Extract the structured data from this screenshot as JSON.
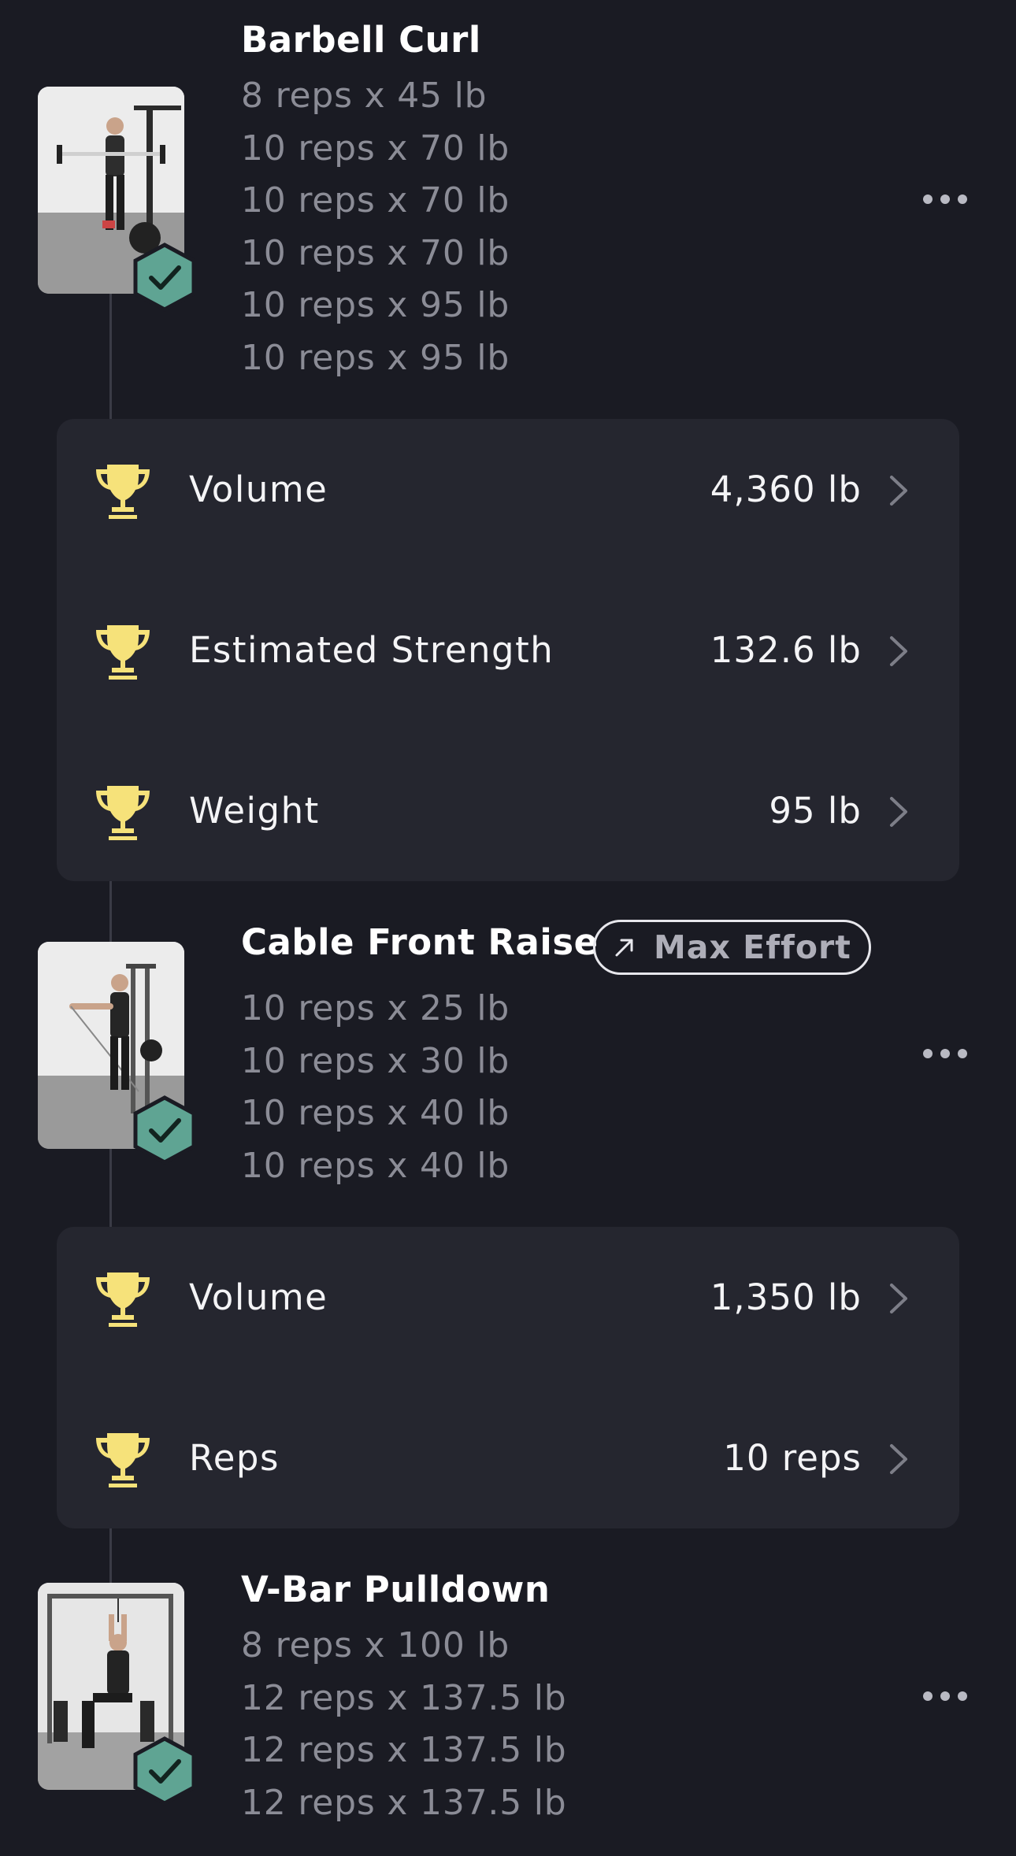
{
  "colors": {
    "background": "#1a1b23",
    "card": "#25262f",
    "trophy": "#f6e27a",
    "check_badge": "#5fa493",
    "muted_text": "#8b8c96"
  },
  "exercises": [
    {
      "title": "Barbell Curl",
      "thumbnail_icon": "exercise-photo",
      "completed_icon": "check-hexagon-icon",
      "sets": [
        "8 reps x 45 lb",
        "10 reps x 70 lb",
        "10 reps x 70 lb",
        "10 reps x 70 lb",
        "10 reps x 95 lb",
        "10 reps x 95 lb"
      ],
      "records": [
        {
          "icon": "trophy-icon",
          "label": "Volume",
          "value": "4,360 lb"
        },
        {
          "icon": "trophy-icon",
          "label": "Estimated Strength",
          "value": "132.6 lb"
        },
        {
          "icon": "trophy-icon",
          "label": "Weight",
          "value": "95 lb"
        }
      ]
    },
    {
      "title": "Cable Front Raise",
      "tag": {
        "icon": "trend-arrow-icon",
        "label": "Max Effort"
      },
      "thumbnail_icon": "exercise-photo",
      "completed_icon": "check-hexagon-icon",
      "sets": [
        "10 reps x 25 lb",
        "10 reps x 30 lb",
        "10 reps x 40 lb",
        "10 reps x 40 lb"
      ],
      "records": [
        {
          "icon": "trophy-icon",
          "label": "Volume",
          "value": "1,350 lb"
        },
        {
          "icon": "trophy-icon",
          "label": "Reps",
          "value": "10 reps"
        }
      ]
    },
    {
      "title": "V-Bar Pulldown",
      "thumbnail_icon": "exercise-photo",
      "completed_icon": "check-hexagon-icon",
      "sets": [
        "8 reps x 100 lb",
        "12 reps x 137.5 lb",
        "12 reps x 137.5 lb",
        "12 reps x 137.5 lb"
      ]
    }
  ]
}
